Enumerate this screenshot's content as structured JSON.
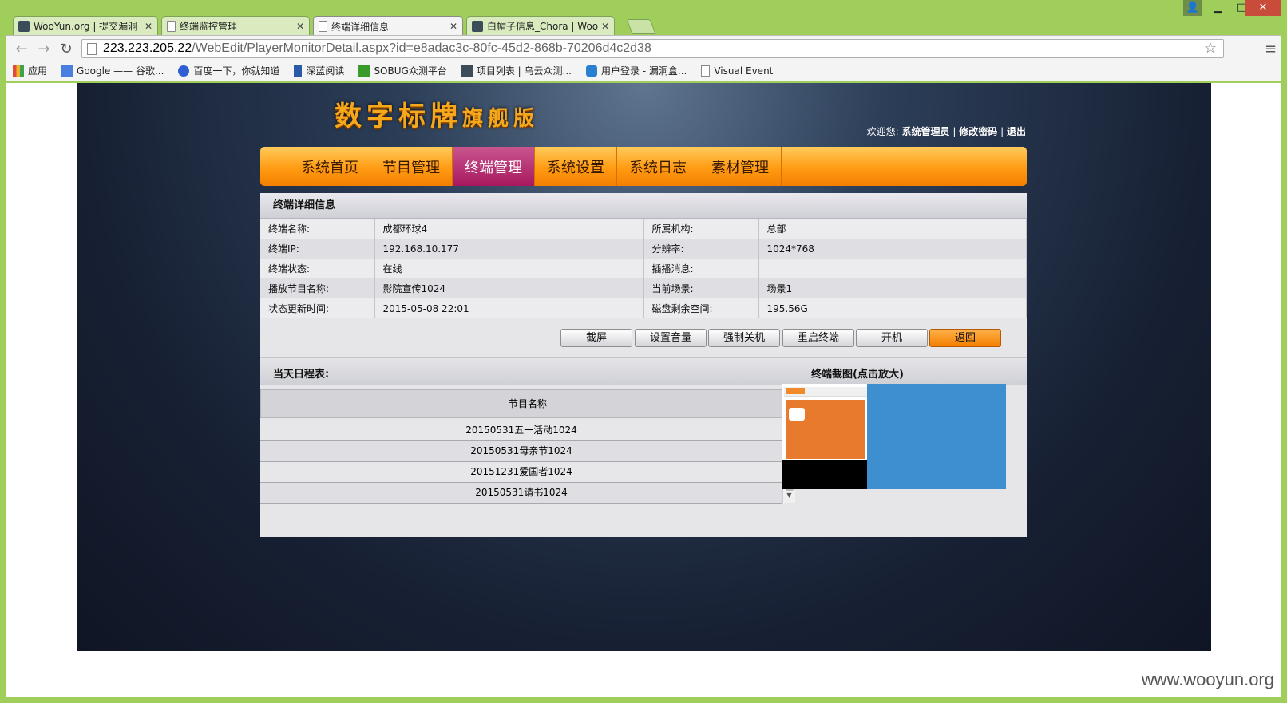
{
  "browser": {
    "tabs": [
      {
        "title": "WooYun.org | 提交漏洞",
        "icon": "wooyun-icon"
      },
      {
        "title": "终端监控管理",
        "icon": "page-icon"
      },
      {
        "title": "终端详细信息",
        "icon": "page-icon",
        "active": true
      },
      {
        "title": "白帽子信息_Chora | Woo",
        "icon": "wooyun-icon"
      }
    ],
    "url_host": "223.223.205.22",
    "url_path": "/WebEdit/PlayerMonitorDetail.aspx?id=e8adac3c-80fc-45d2-868b-70206d4c2d38",
    "bookmarks": [
      {
        "label": "应用",
        "icon": "apps-icon",
        "color": "#e04b3a"
      },
      {
        "label": "Google —— 谷歌...",
        "icon": "google-icon",
        "color": "#4a7fe0"
      },
      {
        "label": "百度一下，你就知道",
        "icon": "baidu-icon",
        "color": "#2f5fd0"
      },
      {
        "label": "深蓝阅读",
        "icon": "bookmark-icon",
        "color": "#2b5aa6"
      },
      {
        "label": "SOBUG众测平台",
        "icon": "sobug-icon",
        "color": "#3a9a2a"
      },
      {
        "label": "项目列表 | 乌云众测...",
        "icon": "wooyun-icon",
        "color": "#3b4d5a"
      },
      {
        "label": "用户登录 - 漏洞盒...",
        "icon": "shield-icon",
        "color": "#2a7fd0"
      },
      {
        "label": "Visual Event",
        "icon": "page-icon",
        "color": "#ffffff"
      }
    ]
  },
  "site": {
    "logo_main": "数字标牌",
    "logo_sub": "旗舰版",
    "welcome": "欢迎您:",
    "user_link": "系统管理员",
    "sep": "|",
    "change_pwd": "修改密码",
    "logout": "退出",
    "nav": [
      "系统首页",
      "节目管理",
      "终端管理",
      "系统设置",
      "系统日志",
      "素材管理"
    ],
    "nav_active_index": 2
  },
  "panel": {
    "title": "终端详细信息",
    "rows": [
      {
        "k1": "终端名称:",
        "v1": "成都环球4",
        "k2": "所属机构:",
        "v2": "总部"
      },
      {
        "k1": "终端IP:",
        "v1": "192.168.10.177",
        "k2": "分辨率:",
        "v2": "1024*768"
      },
      {
        "k1": "终端状态:",
        "v1": "在线",
        "k2": "插播消息:",
        "v2": ""
      },
      {
        "k1": "播放节目名称:",
        "v1": "影院宣传1024",
        "k2": "当前场景:",
        "v2": "场景1"
      },
      {
        "k1": "状态更新时间:",
        "v1": "2015-05-08 22:01",
        "k2": "磁盘剩余空间:",
        "v2": "195.56G"
      }
    ],
    "buttons": {
      "screenshot": "截屏",
      "volume": "设置音量",
      "shutdown": "强制关机",
      "restart": "重启终端",
      "power_on": "开机",
      "back": "返回"
    },
    "schedule_title": "当天日程表:",
    "screenshot_title": "终端截图(点击放大)",
    "schedule_column": "节目名称",
    "schedule_items": [
      "20150531五一活动1024",
      "20150531母亲节1024",
      "20151231爱国者1024",
      "20150531请书1024"
    ]
  },
  "watermark": "www.wooyun.org"
}
